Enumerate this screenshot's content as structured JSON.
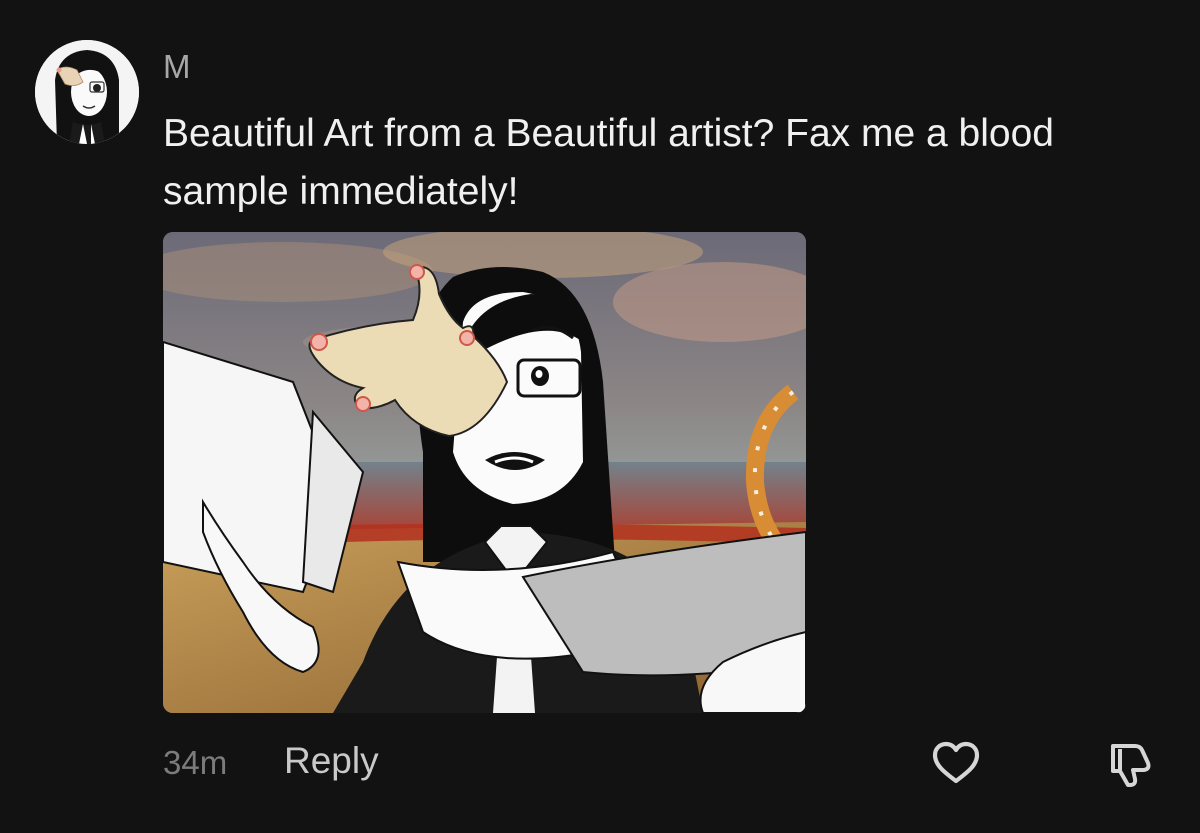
{
  "comment": {
    "author": "M",
    "text": "Beautiful Art from a Beautiful artist? Fax me a blood sample immediately!",
    "timestamp": "34m",
    "reply_label": "Reply"
  },
  "icons": {
    "like": "heart-icon",
    "dislike": "thumbs-down-icon"
  },
  "colors": {
    "background": "#121212",
    "text": "#f0f0f0",
    "username": "#a7a7a7",
    "timestamp": "#7c7c7c",
    "action": "#c9c9c9"
  }
}
